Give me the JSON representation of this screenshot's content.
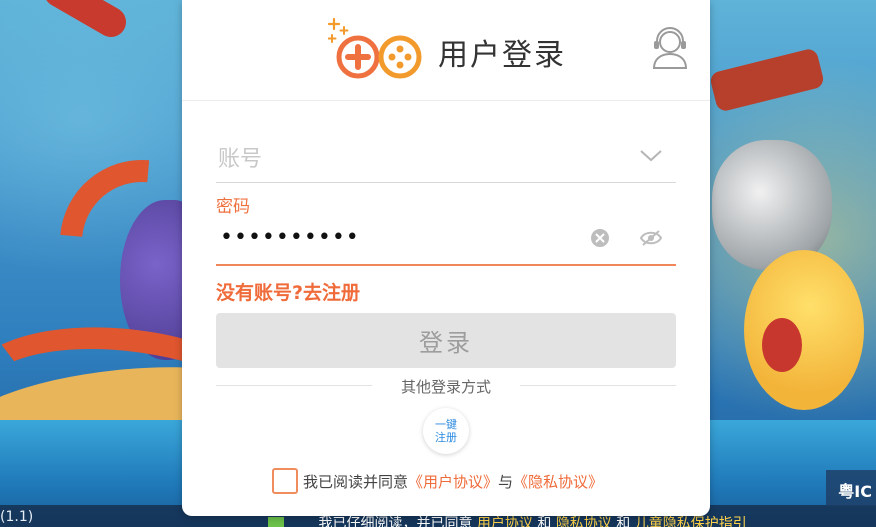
{
  "header": {
    "title": "用户登录",
    "logo_icon": "gamepad-logo-icon",
    "support_icon": "customer-service-icon"
  },
  "account": {
    "placeholder": "账号",
    "value": ""
  },
  "password": {
    "label": "密码",
    "masked_value": "••••••••••"
  },
  "register_link": "没有账号?去注册",
  "login_button": "登录",
  "other_login": {
    "label": "其他登录方式",
    "quick_register_line1": "一键",
    "quick_register_line2": "注册"
  },
  "agreement": {
    "prefix": "我已阅读并同意",
    "user_agreement": "《用户协议》",
    "conjunction": "与",
    "privacy_agreement": "《隐私协议》"
  },
  "background": {
    "left_text": "(1.1)",
    "right_text": "粤IC",
    "notice": {
      "prefix": "我已仔细阅读，并已同意",
      "link1": "用户协议",
      "mid1": "和",
      "link2": "隐私协议",
      "mid2": "和",
      "link3": "儿童隐私保护指引"
    }
  },
  "colors": {
    "accent": "#f06b3a",
    "button_bg": "#e3e3e3",
    "button_text": "#9d9d9d",
    "link_blue": "#2b8ae0"
  }
}
